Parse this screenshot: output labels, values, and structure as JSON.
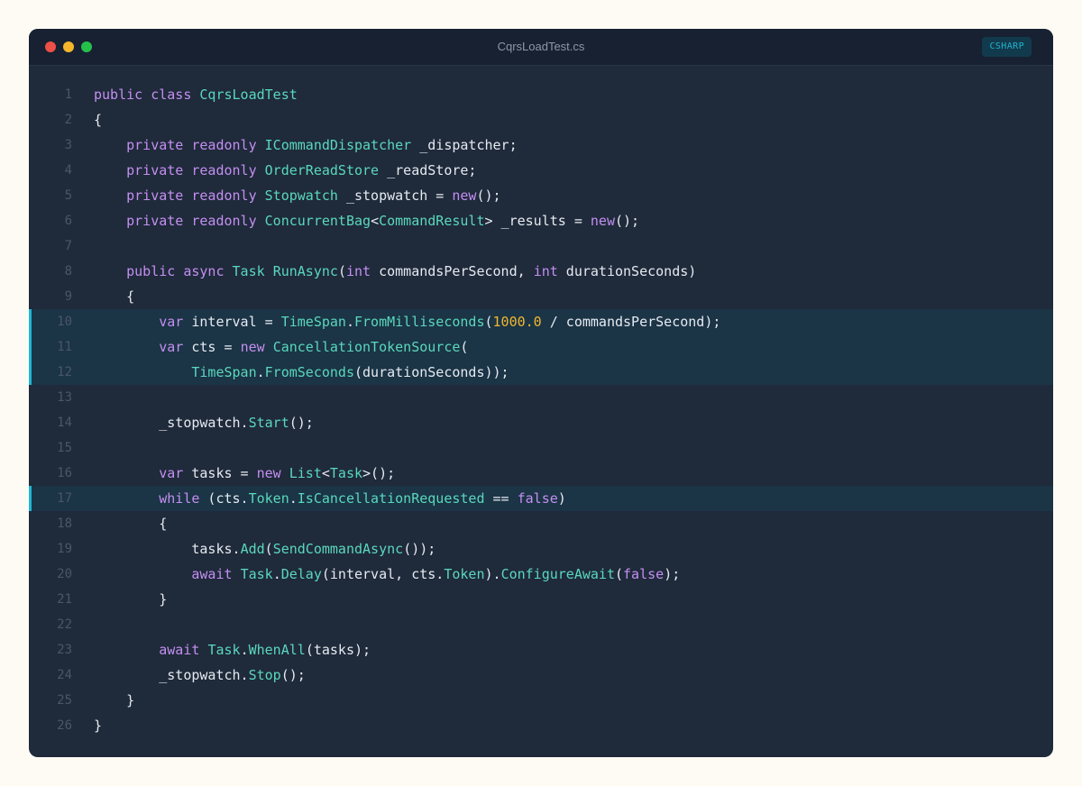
{
  "window": {
    "title": "CqrsLoadTest.cs",
    "language_badge": "CSHARP"
  },
  "colors": {
    "keyword": "#c48ff0",
    "type": "#5ad8bd",
    "number": "#f0b630",
    "plain": "#e6eaf0",
    "highlight_bar": "#1fb6d4"
  },
  "code": {
    "highlighted_lines": [
      10,
      11,
      12,
      17
    ],
    "lines": [
      {
        "n": "1",
        "tokens": [
          [
            "kw",
            "public"
          ],
          [
            "pl",
            " "
          ],
          [
            "kw",
            "class"
          ],
          [
            "pl",
            " "
          ],
          [
            "ty",
            "CqrsLoadTest"
          ]
        ]
      },
      {
        "n": "2",
        "tokens": [
          [
            "pl",
            "{"
          ]
        ]
      },
      {
        "n": "3",
        "tokens": [
          [
            "pl",
            "    "
          ],
          [
            "kw",
            "private"
          ],
          [
            "pl",
            " "
          ],
          [
            "kw",
            "readonly"
          ],
          [
            "pl",
            " "
          ],
          [
            "ty",
            "ICommandDispatcher"
          ],
          [
            "pl",
            " _dispatcher;"
          ]
        ]
      },
      {
        "n": "4",
        "tokens": [
          [
            "pl",
            "    "
          ],
          [
            "kw",
            "private"
          ],
          [
            "pl",
            " "
          ],
          [
            "kw",
            "readonly"
          ],
          [
            "pl",
            " "
          ],
          [
            "ty",
            "OrderReadStore"
          ],
          [
            "pl",
            " _readStore;"
          ]
        ]
      },
      {
        "n": "5",
        "tokens": [
          [
            "pl",
            "    "
          ],
          [
            "kw",
            "private"
          ],
          [
            "pl",
            " "
          ],
          [
            "kw",
            "readonly"
          ],
          [
            "pl",
            " "
          ],
          [
            "ty",
            "Stopwatch"
          ],
          [
            "pl",
            " _stopwatch = "
          ],
          [
            "kw",
            "new"
          ],
          [
            "pl",
            "();"
          ]
        ]
      },
      {
        "n": "6",
        "tokens": [
          [
            "pl",
            "    "
          ],
          [
            "kw",
            "private"
          ],
          [
            "pl",
            " "
          ],
          [
            "kw",
            "readonly"
          ],
          [
            "pl",
            " "
          ],
          [
            "ty",
            "ConcurrentBag"
          ],
          [
            "pl",
            "<"
          ],
          [
            "ty",
            "CommandResult"
          ],
          [
            "pl",
            "> _results = "
          ],
          [
            "kw",
            "new"
          ],
          [
            "pl",
            "();"
          ]
        ]
      },
      {
        "n": "7",
        "tokens": []
      },
      {
        "n": "8",
        "tokens": [
          [
            "pl",
            "    "
          ],
          [
            "kw",
            "public"
          ],
          [
            "pl",
            " "
          ],
          [
            "kw",
            "async"
          ],
          [
            "pl",
            " "
          ],
          [
            "ty",
            "Task"
          ],
          [
            "pl",
            " "
          ],
          [
            "ty",
            "RunAsync"
          ],
          [
            "pl",
            "("
          ],
          [
            "kw",
            "int"
          ],
          [
            "pl",
            " commandsPerSecond, "
          ],
          [
            "kw",
            "int"
          ],
          [
            "pl",
            " durationSeconds)"
          ]
        ]
      },
      {
        "n": "9",
        "tokens": [
          [
            "pl",
            "    {"
          ]
        ]
      },
      {
        "n": "10",
        "tokens": [
          [
            "pl",
            "        "
          ],
          [
            "kw",
            "var"
          ],
          [
            "pl",
            " interval = "
          ],
          [
            "ty",
            "TimeSpan"
          ],
          [
            "pl",
            "."
          ],
          [
            "ty",
            "FromMilliseconds"
          ],
          [
            "pl",
            "("
          ],
          [
            "nu",
            "1000.0"
          ],
          [
            "pl",
            " / commandsPerSecond);"
          ]
        ]
      },
      {
        "n": "11",
        "tokens": [
          [
            "pl",
            "        "
          ],
          [
            "kw",
            "var"
          ],
          [
            "pl",
            " cts = "
          ],
          [
            "kw",
            "new"
          ],
          [
            "pl",
            " "
          ],
          [
            "ty",
            "CancellationTokenSource"
          ],
          [
            "pl",
            "("
          ]
        ]
      },
      {
        "n": "12",
        "tokens": [
          [
            "pl",
            "            "
          ],
          [
            "ty",
            "TimeSpan"
          ],
          [
            "pl",
            "."
          ],
          [
            "ty",
            "FromSeconds"
          ],
          [
            "pl",
            "(durationSeconds));"
          ]
        ]
      },
      {
        "n": "13",
        "tokens": []
      },
      {
        "n": "14",
        "tokens": [
          [
            "pl",
            "        _stopwatch."
          ],
          [
            "ty",
            "Start"
          ],
          [
            "pl",
            "();"
          ]
        ]
      },
      {
        "n": "15",
        "tokens": []
      },
      {
        "n": "16",
        "tokens": [
          [
            "pl",
            "        "
          ],
          [
            "kw",
            "var"
          ],
          [
            "pl",
            " tasks = "
          ],
          [
            "kw",
            "new"
          ],
          [
            "pl",
            " "
          ],
          [
            "ty",
            "List"
          ],
          [
            "pl",
            "<"
          ],
          [
            "ty",
            "Task"
          ],
          [
            "pl",
            ">();"
          ]
        ]
      },
      {
        "n": "17",
        "tokens": [
          [
            "pl",
            "        "
          ],
          [
            "kw",
            "while"
          ],
          [
            "pl",
            " (cts."
          ],
          [
            "ty",
            "Token"
          ],
          [
            "pl",
            "."
          ],
          [
            "ty",
            "IsCancellationRequested"
          ],
          [
            "pl",
            " == "
          ],
          [
            "kw",
            "false"
          ],
          [
            "pl",
            ")"
          ]
        ]
      },
      {
        "n": "18",
        "tokens": [
          [
            "pl",
            "        {"
          ]
        ]
      },
      {
        "n": "19",
        "tokens": [
          [
            "pl",
            "            tasks."
          ],
          [
            "ty",
            "Add"
          ],
          [
            "pl",
            "("
          ],
          [
            "ty",
            "SendCommandAsync"
          ],
          [
            "pl",
            "());"
          ]
        ]
      },
      {
        "n": "20",
        "tokens": [
          [
            "pl",
            "            "
          ],
          [
            "kw",
            "await"
          ],
          [
            "pl",
            " "
          ],
          [
            "ty",
            "Task"
          ],
          [
            "pl",
            "."
          ],
          [
            "ty",
            "Delay"
          ],
          [
            "pl",
            "(interval, cts."
          ],
          [
            "ty",
            "Token"
          ],
          [
            "pl",
            ")."
          ],
          [
            "ty",
            "ConfigureAwait"
          ],
          [
            "pl",
            "("
          ],
          [
            "kw",
            "false"
          ],
          [
            "pl",
            ");"
          ]
        ]
      },
      {
        "n": "21",
        "tokens": [
          [
            "pl",
            "        }"
          ]
        ]
      },
      {
        "n": "22",
        "tokens": []
      },
      {
        "n": "23",
        "tokens": [
          [
            "pl",
            "        "
          ],
          [
            "kw",
            "await"
          ],
          [
            "pl",
            " "
          ],
          [
            "ty",
            "Task"
          ],
          [
            "pl",
            "."
          ],
          [
            "ty",
            "WhenAll"
          ],
          [
            "pl",
            "(tasks);"
          ]
        ]
      },
      {
        "n": "24",
        "tokens": [
          [
            "pl",
            "        _stopwatch."
          ],
          [
            "ty",
            "Stop"
          ],
          [
            "pl",
            "();"
          ]
        ]
      },
      {
        "n": "25",
        "tokens": [
          [
            "pl",
            "    }"
          ]
        ]
      },
      {
        "n": "26",
        "tokens": [
          [
            "pl",
            "}"
          ]
        ]
      }
    ]
  }
}
